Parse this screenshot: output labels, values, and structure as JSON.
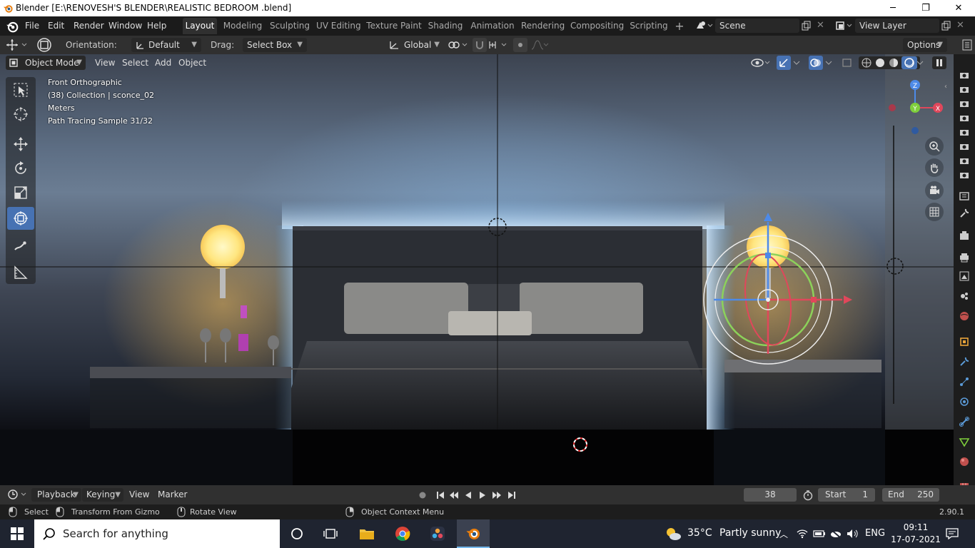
{
  "window": {
    "title": "Blender [E:\\RENOVESH'S BLENDER\\REALISTIC BEDROOM .blend]",
    "minimize": "─",
    "maximize": "❐",
    "close": "✕"
  },
  "menu": [
    "File",
    "Edit",
    "Render",
    "Window",
    "Help"
  ],
  "workspaces": [
    {
      "label": "Layout",
      "active": true
    },
    {
      "label": "Modeling"
    },
    {
      "label": "Sculpting"
    },
    {
      "label": "UV Editing"
    },
    {
      "label": "Texture Paint"
    },
    {
      "label": "Shading"
    },
    {
      "label": "Animation"
    },
    {
      "label": "Rendering"
    },
    {
      "label": "Compositing"
    },
    {
      "label": "Scripting"
    }
  ],
  "add_workspace": "+",
  "scene": {
    "name": "Scene"
  },
  "view_layer": {
    "name": "View Layer"
  },
  "header": {
    "orientation_label": "Orientation:",
    "orientation_value": "Default",
    "drag_label": "Drag:",
    "drag_value": "Select Box",
    "transform_orientation": "Global",
    "options": "Options"
  },
  "viewport_header": {
    "mode": "Object Mode",
    "menus": [
      "View",
      "Select",
      "Add",
      "Object"
    ]
  },
  "overlay": {
    "view": "Front Orthographic",
    "collection": "(38) Collection | sconce_02",
    "units": "Meters",
    "render_status": "Path Tracing Sample 31/32"
  },
  "gizmo": {
    "z": "Z",
    "y": "Y",
    "x": "X"
  },
  "timeline": {
    "playback": "Playback",
    "keying": "Keying",
    "view": "View",
    "marker": "Marker",
    "current_frame": "38",
    "start_label": "Start",
    "start": "1",
    "end_label": "End",
    "end": "250"
  },
  "status": {
    "select": "Select",
    "transform": "Transform From Gizmo",
    "rotate": "Rotate View",
    "context": "Object Context Menu",
    "version": "2.90.1"
  },
  "taskbar": {
    "search_placeholder": "Search for anything",
    "weather_temp": "35°C",
    "weather_text": "Partly sunny",
    "language": "ENG",
    "time": "09:11",
    "date": "17-07-2021"
  },
  "colors": {
    "accent": "#4772b3",
    "x_axis": "#e0475b",
    "y_axis": "#7fcf3c",
    "z_axis": "#4d8ae8"
  }
}
